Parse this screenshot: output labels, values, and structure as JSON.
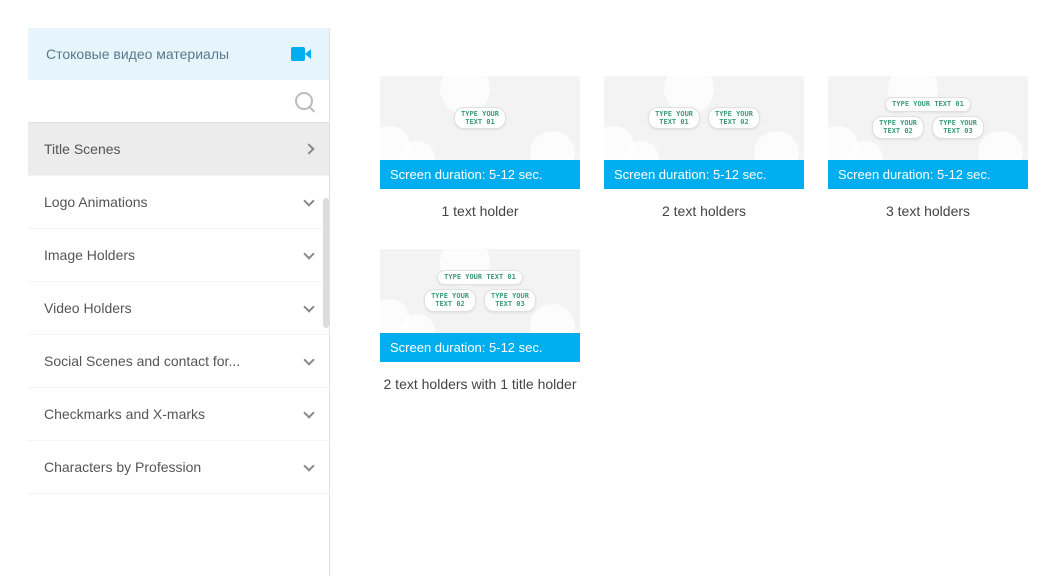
{
  "sidebar": {
    "header": "Стоковые видео материалы",
    "categories": [
      {
        "label": "Title Scenes",
        "active": true,
        "chev": "right"
      },
      {
        "label": "Logo Animations",
        "active": false,
        "chev": "down"
      },
      {
        "label": "Image Holders",
        "active": false,
        "chev": "down"
      },
      {
        "label": "Video Holders",
        "active": false,
        "chev": "down"
      },
      {
        "label": "Social Scenes and contact for...",
        "active": false,
        "chev": "down"
      },
      {
        "label": "Checkmarks and X-marks",
        "active": false,
        "chev": "down"
      },
      {
        "label": "Characters by Profession",
        "active": false,
        "chev": "down"
      }
    ]
  },
  "cards": [
    {
      "duration": "Screen duration: 5-12 sec.",
      "caption": "1 text holder",
      "tags": [
        [
          "TYPE YOUR",
          "TEXT 01"
        ]
      ]
    },
    {
      "duration": "Screen duration: 5-12 sec.",
      "caption": "2 text holders",
      "tags": [
        [
          "TYPE YOUR",
          "TEXT 01"
        ],
        [
          "TYPE YOUR",
          "TEXT 02"
        ]
      ]
    },
    {
      "duration": "Screen duration: 5-12 sec.",
      "caption": "3 text holders",
      "tags_top": "TYPE YOUR TEXT 01",
      "tags": [
        [
          "TYPE YOUR",
          "TEXT 02"
        ],
        [
          "TYPE YOUR",
          "TEXT 03"
        ]
      ]
    },
    {
      "duration": "Screen duration: 5-12 sec.",
      "caption": "2 text holders with 1 title holder",
      "tags_top": "TYPE YOUR TEXT 01",
      "tags": [
        [
          "TYPE YOUR",
          "TEXT 02"
        ],
        [
          "TYPE YOUR",
          "TEXT 03"
        ]
      ]
    }
  ]
}
